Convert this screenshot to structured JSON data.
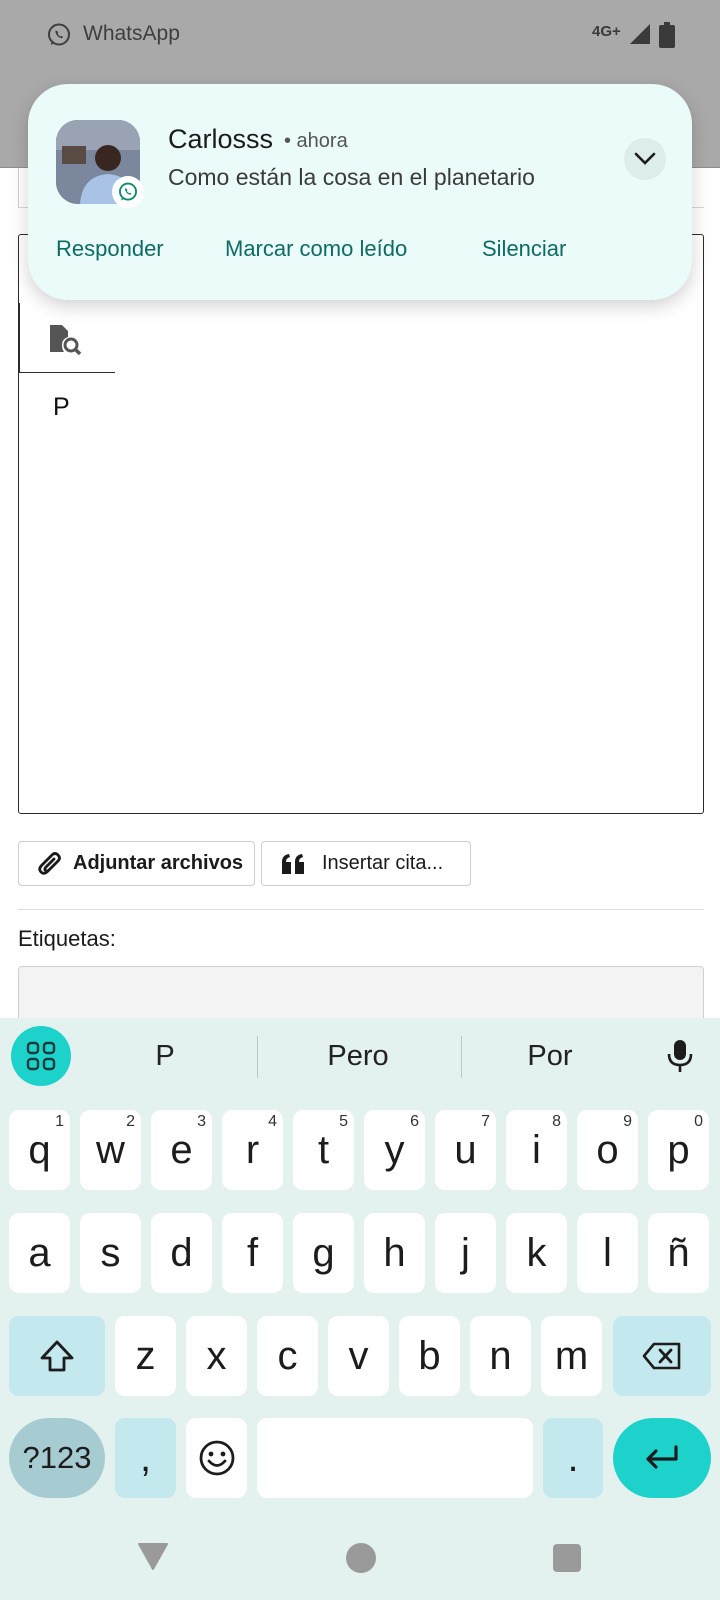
{
  "status_bar": {
    "app_name": "WhatsApp",
    "network": "4G+"
  },
  "notification": {
    "sender": "Carlosss",
    "time": "• ahora",
    "message": "Como están la cosa en el planetario",
    "actions": [
      "Responder",
      "Marcar como leído",
      "Silenciar"
    ],
    "accent_color": "#0d6b62"
  },
  "editor": {
    "text": "P"
  },
  "toolbar": {
    "attach_label": "Adjuntar archivos",
    "quote_label": "Insertar cita..."
  },
  "tags": {
    "label": "Etiquetas:",
    "value": ""
  },
  "keyboard": {
    "suggestions": [
      "P",
      "Pero",
      "Por"
    ],
    "row1": [
      {
        "k": "q",
        "n": "1"
      },
      {
        "k": "w",
        "n": "2"
      },
      {
        "k": "e",
        "n": "3"
      },
      {
        "k": "r",
        "n": "4"
      },
      {
        "k": "t",
        "n": "5"
      },
      {
        "k": "y",
        "n": "6"
      },
      {
        "k": "u",
        "n": "7"
      },
      {
        "k": "i",
        "n": "8"
      },
      {
        "k": "o",
        "n": "9"
      },
      {
        "k": "p",
        "n": "0"
      }
    ],
    "row2": [
      "a",
      "s",
      "d",
      "f",
      "g",
      "h",
      "j",
      "k",
      "l",
      "ñ"
    ],
    "row3": [
      "z",
      "x",
      "c",
      "v",
      "b",
      "n",
      "m"
    ],
    "symbols_label": "?123",
    "comma": ",",
    "period": "."
  }
}
